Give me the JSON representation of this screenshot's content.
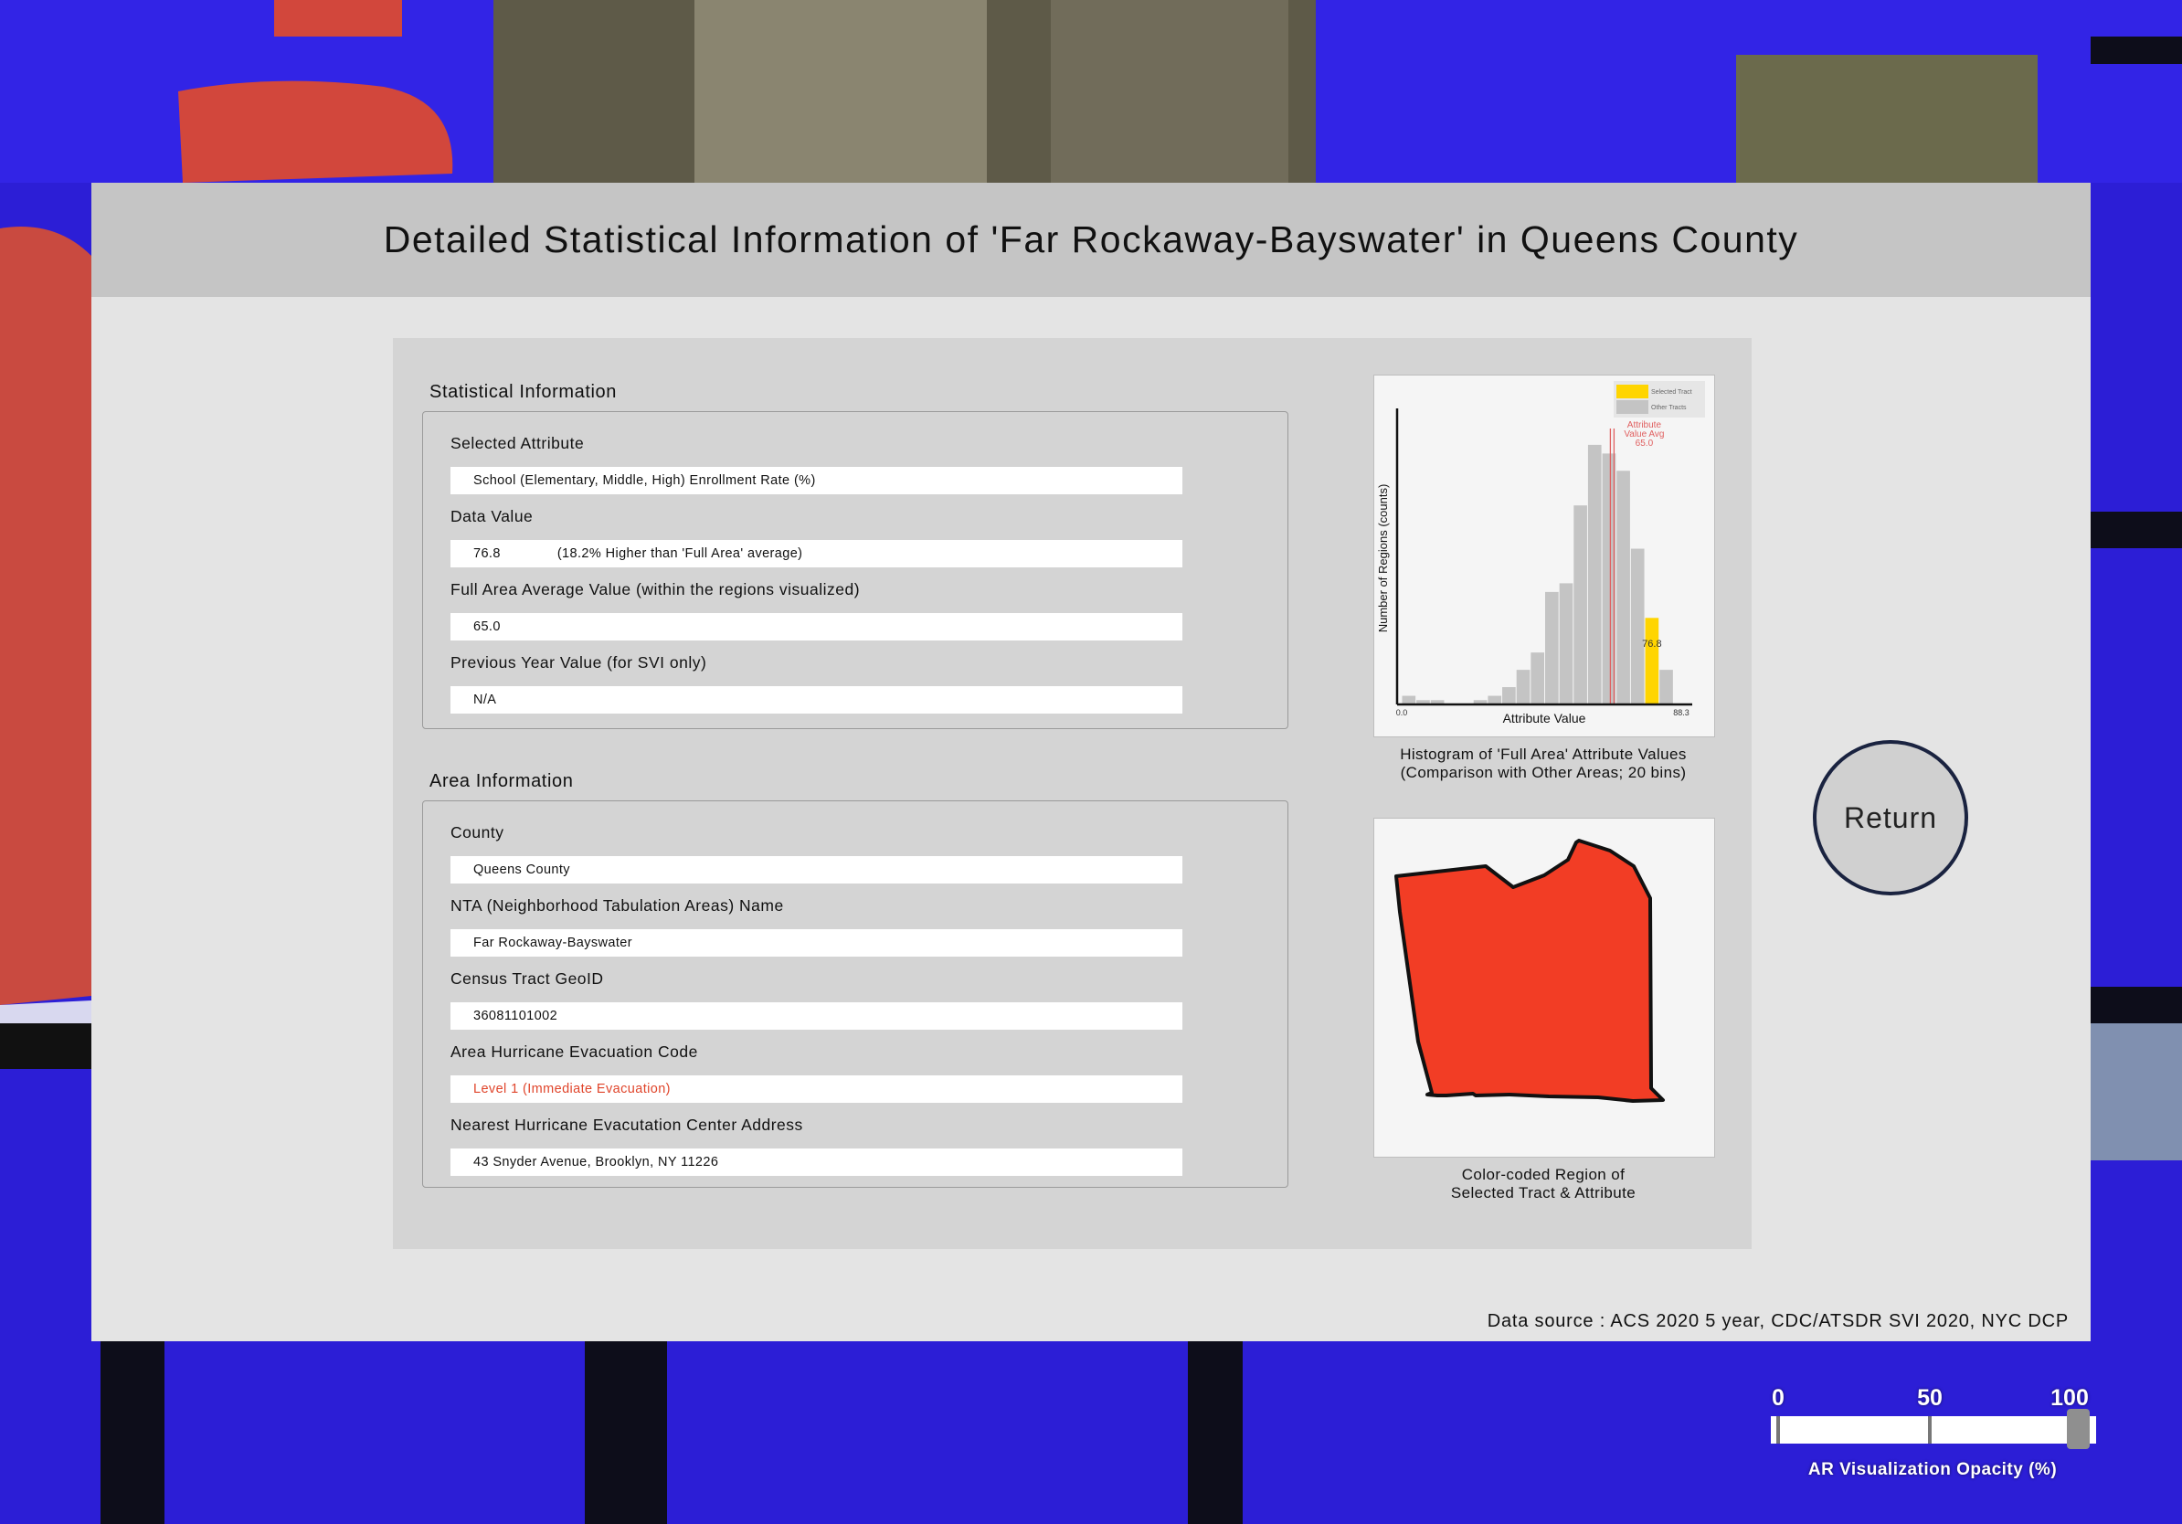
{
  "title": "Detailed Statistical Information of 'Far Rockaway-Bayswater' in Queens County",
  "statistical_info": {
    "heading": "Statistical Information",
    "fields": [
      {
        "label": "Selected Attribute",
        "value": "School (Elementary, Middle, High) Enrollment Rate (%)"
      },
      {
        "label": "Data Value",
        "value": "76.8",
        "note": "(18.2% Higher than 'Full Area' average)"
      },
      {
        "label": "Full Area Average Value (within the regions visualized)",
        "value": "65.0"
      },
      {
        "label": "Previous Year Value (for SVI only)",
        "value": "N/A"
      }
    ]
  },
  "area_info": {
    "heading": "Area Information",
    "fields": [
      {
        "label": "County",
        "value": "Queens County"
      },
      {
        "label": "NTA (Neighborhood Tabulation Areas) Name",
        "value": "Far Rockaway-Bayswater"
      },
      {
        "label": "Census Tract GeoID",
        "value": "36081101002"
      },
      {
        "label": "Area Hurricane Evacuation Code",
        "value": "Level 1 (Immediate Evacuation)"
      },
      {
        "label": "Nearest Hurricane Evacutation Center Address",
        "value": "43 Snyder Avenue, Brooklyn, NY 11226"
      }
    ]
  },
  "chart_data": {
    "type": "bar",
    "bins": 20,
    "xlabel": "Attribute Value",
    "ylabel": "Number of Regions (counts)",
    "xlim": [
      0.0,
      88.3
    ],
    "x_min_label": "0.0",
    "x_max_label": "88.3",
    "values": [
      1,
      0.5,
      0.5,
      0,
      0,
      0.5,
      1,
      2,
      4,
      6,
      13,
      14,
      23,
      30,
      29,
      27,
      18,
      10,
      4,
      0
    ],
    "selected_bin": 17,
    "selected_label": "76.8",
    "avg_value": 65.0,
    "avg_label": [
      "Attribute",
      "Value Avg",
      "65.0"
    ],
    "legend": [
      {
        "name": "Selected Tract",
        "color": "#ffd500"
      },
      {
        "name": "Other Tracts",
        "color": "#c4c4c4"
      }
    ],
    "legend_position": "top-right",
    "colors": {
      "bar": "#c4c4c4",
      "selected": "#ffd500",
      "avg_line": "#e06060"
    }
  },
  "histogram_caption": [
    "Histogram of 'Full Area' Attribute Values",
    "(Comparison with Other Areas; 20 bins)"
  ],
  "region": {
    "fill": "#f23d25",
    "stroke": "#111111"
  },
  "region_caption": [
    "Color-coded Region of",
    "Selected Tract & Attribute"
  ],
  "return_label": "Return",
  "data_source": "Data source : ACS 2020 5 year, CDC/ATSDR SVI 2020, NYC DCP",
  "opacity_slider": {
    "ticks": [
      "0",
      "50",
      "100"
    ],
    "value_percent": 100,
    "label": "AR Visualization Opacity (%)"
  }
}
